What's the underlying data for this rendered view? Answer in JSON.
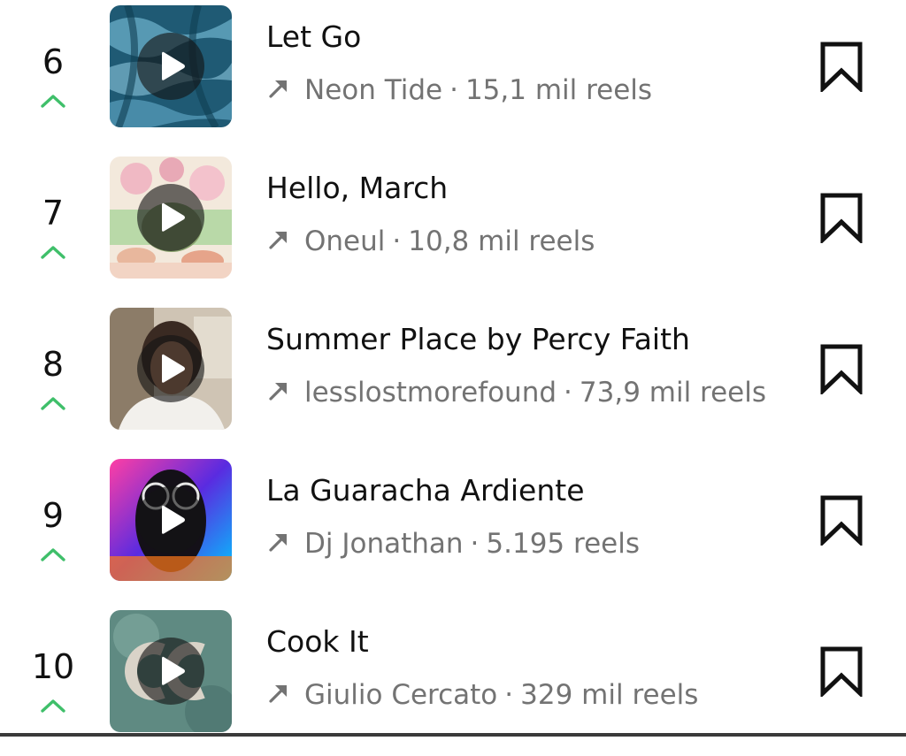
{
  "colors": {
    "trend_up": "#3fbf6a",
    "meta_text": "#737373",
    "title_text": "#111111"
  },
  "icons": {
    "trend": "chevron-up-icon",
    "source": "arrow-up-right-icon",
    "play": "play-icon",
    "save": "bookmark-icon"
  },
  "tracks": [
    {
      "rank": "6",
      "title": "Let Go",
      "artist": "Neon Tide",
      "reels": "15,1 mil reels"
    },
    {
      "rank": "7",
      "title": "Hello, March",
      "artist": "Oneul",
      "reels": "10,8 mil reels"
    },
    {
      "rank": "8",
      "title": "Summer Place by Percy Faith",
      "artist": "lesslostmorefound",
      "reels": "73,9 mil reels"
    },
    {
      "rank": "9",
      "title": "La Guaracha Ardiente",
      "artist": "Dj Jonathan",
      "reels": "5.195 reels"
    },
    {
      "rank": "10",
      "title": "Cook It",
      "artist": "Giulio Cercato",
      "reels": "329 mil reels"
    }
  ],
  "separator": "·"
}
